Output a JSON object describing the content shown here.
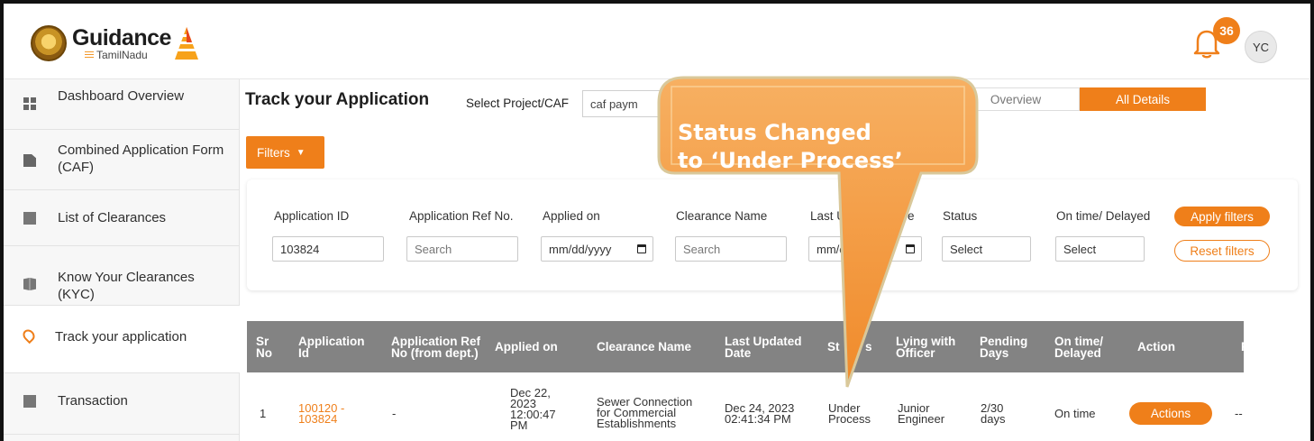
{
  "header": {
    "brand_main": "Guidance",
    "brand_sub": "TamilNadu",
    "notification_count": "36",
    "avatar_initials": "YC"
  },
  "sidebar": {
    "items": [
      {
        "label": "Dashboard Overview",
        "icon": "dashboard-icon"
      },
      {
        "label": "Combined Application Form (CAF)",
        "icon": "document-icon"
      },
      {
        "label": "List of Clearances",
        "icon": "list-icon"
      },
      {
        "label": "Know Your Clearances (KYC)",
        "icon": "book-icon"
      },
      {
        "label": "Track your application",
        "icon": "location-pin-icon"
      },
      {
        "label": "Transaction",
        "icon": "transaction-icon"
      }
    ]
  },
  "main": {
    "title": "Track your Application",
    "select_label": "Select Project/CAF",
    "select_value": "caf paym",
    "tabs": [
      "Overview",
      "All Details"
    ],
    "filters_label": "Filters"
  },
  "filters": {
    "application_id": {
      "label": "Application ID",
      "value": "103824"
    },
    "application_ref": {
      "label": "Application Ref No.",
      "placeholder": "Search"
    },
    "applied_on": {
      "label": "Applied on",
      "placeholder": "mm/dd/yyyy"
    },
    "clearance_name": {
      "label": "Clearance Name",
      "placeholder": "Search"
    },
    "last_updated": {
      "label_left": "Last U",
      "label_right": "e",
      "placeholder": "mm/c"
    },
    "status": {
      "label": "Status",
      "value": "Select"
    },
    "on_time": {
      "label": "On time/ Delayed",
      "value": "Select"
    },
    "apply_label": "Apply filters",
    "reset_label": "Reset filters"
  },
  "table": {
    "headers": {
      "sr": [
        "Sr",
        "No"
      ],
      "app_id": [
        "Application",
        "Id"
      ],
      "app_ref": [
        "Application Ref",
        "No (from dept.)"
      ],
      "applied_on": "Applied on",
      "clearance": "Clearance Name",
      "last_updated": [
        "Last Updated",
        "Date"
      ],
      "status": [
        "St",
        "s"
      ],
      "lying": [
        "Lying with",
        "Officer"
      ],
      "pending": [
        "Pending",
        "Days"
      ],
      "on_time": [
        "On time/",
        "Delayed"
      ],
      "action": "Action",
      "extra": "F"
    },
    "row": {
      "sr": "1",
      "app_id": [
        "100120 -",
        "103824"
      ],
      "app_ref": "-",
      "applied_on": [
        "Dec 22,",
        "2023",
        "12:00:47",
        "PM"
      ],
      "clearance": [
        "Sewer Connection",
        "for Commercial",
        "Establishments"
      ],
      "last_updated": [
        "Dec 24, 2023",
        "02:41:34 PM"
      ],
      "status": [
        "Under",
        "Process"
      ],
      "lying": [
        "Junior",
        "Engineer"
      ],
      "pending": [
        "2/30",
        "days"
      ],
      "on_time": "On time",
      "action_label": "Actions",
      "extra": "--"
    }
  },
  "callout": {
    "line1": "Status Changed",
    "line2": "to ‘Under Process’"
  },
  "colors": {
    "accent": "#ef7f1a",
    "table_header": "#838383",
    "callout_fill": "#f39a3b"
  }
}
